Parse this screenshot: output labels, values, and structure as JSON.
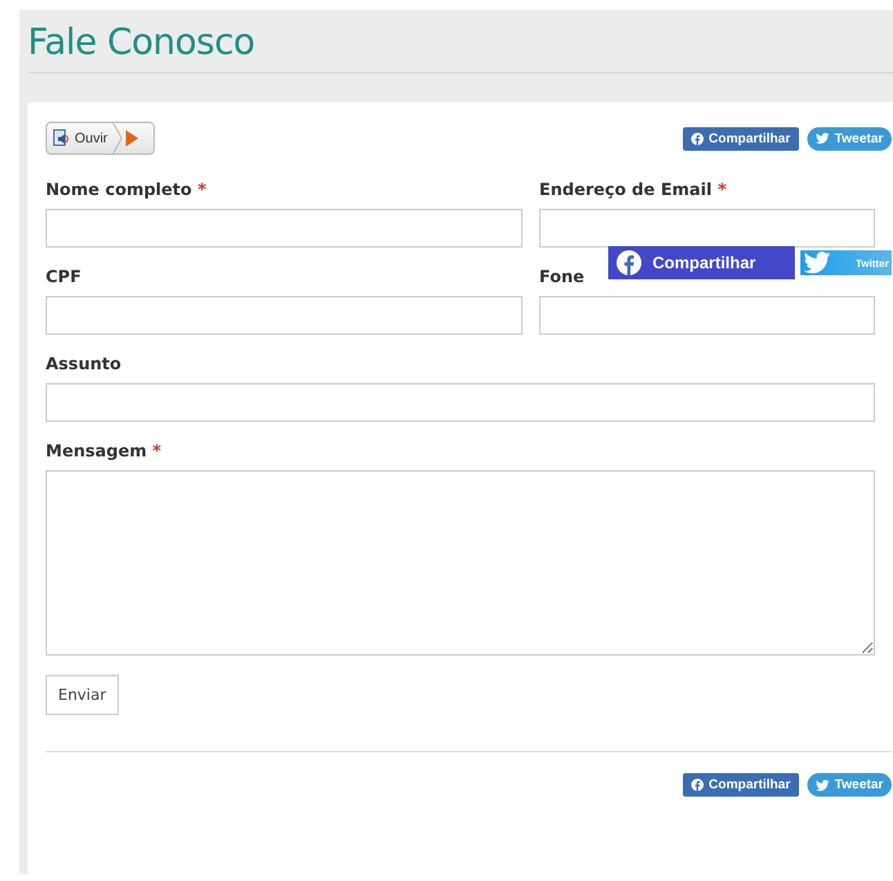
{
  "title": "Fale Conosco",
  "listen_button": {
    "label": "Ouvir"
  },
  "share_top": [
    {
      "kind": "facebook",
      "label": "Compartilhar"
    },
    {
      "kind": "twitter",
      "label": "Tweetar"
    }
  ],
  "required_mark": "*",
  "form_rows": [
    [
      {
        "label": "Nome completo",
        "required": true,
        "kind": "input"
      },
      {
        "label": "Endereço de Email",
        "required": true,
        "kind": "input"
      }
    ],
    [
      {
        "label": "CPF",
        "required": false,
        "kind": "input"
      },
      {
        "label": "Fone",
        "required": false,
        "kind": "input"
      }
    ],
    [
      {
        "label": "Assunto",
        "required": false,
        "kind": "input"
      }
    ],
    [
      {
        "label": "Mensagem",
        "required": true,
        "kind": "textarea"
      }
    ]
  ],
  "submit_button": {
    "label": "Enviar"
  },
  "share_bottom": [
    {
      "kind": "facebook",
      "label": "Compartilhar"
    },
    {
      "kind": "twitter",
      "label": "Tweetar"
    }
  ],
  "floating_share": [
    {
      "kind": "facebook",
      "label": "Compartilhar"
    },
    {
      "kind": "twitter",
      "label": "Twitter"
    }
  ]
}
